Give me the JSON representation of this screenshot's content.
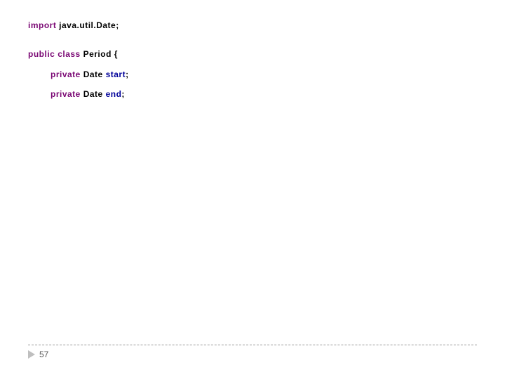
{
  "code": {
    "line1": {
      "kw_import": "import",
      "rest": " java.util.Date;"
    },
    "line2": {
      "kw_public": "public",
      "kw_class": "class",
      "typ_period": "Period",
      "brace": " {"
    },
    "line3": {
      "kw_private": "private",
      "typ_date": "Date",
      "mem_start": "start",
      "semi": ";"
    },
    "line4": {
      "kw_private": "private",
      "typ_date": "Date",
      "mem_end": "end",
      "semi": ";"
    }
  },
  "footer": {
    "page_number": "57"
  }
}
